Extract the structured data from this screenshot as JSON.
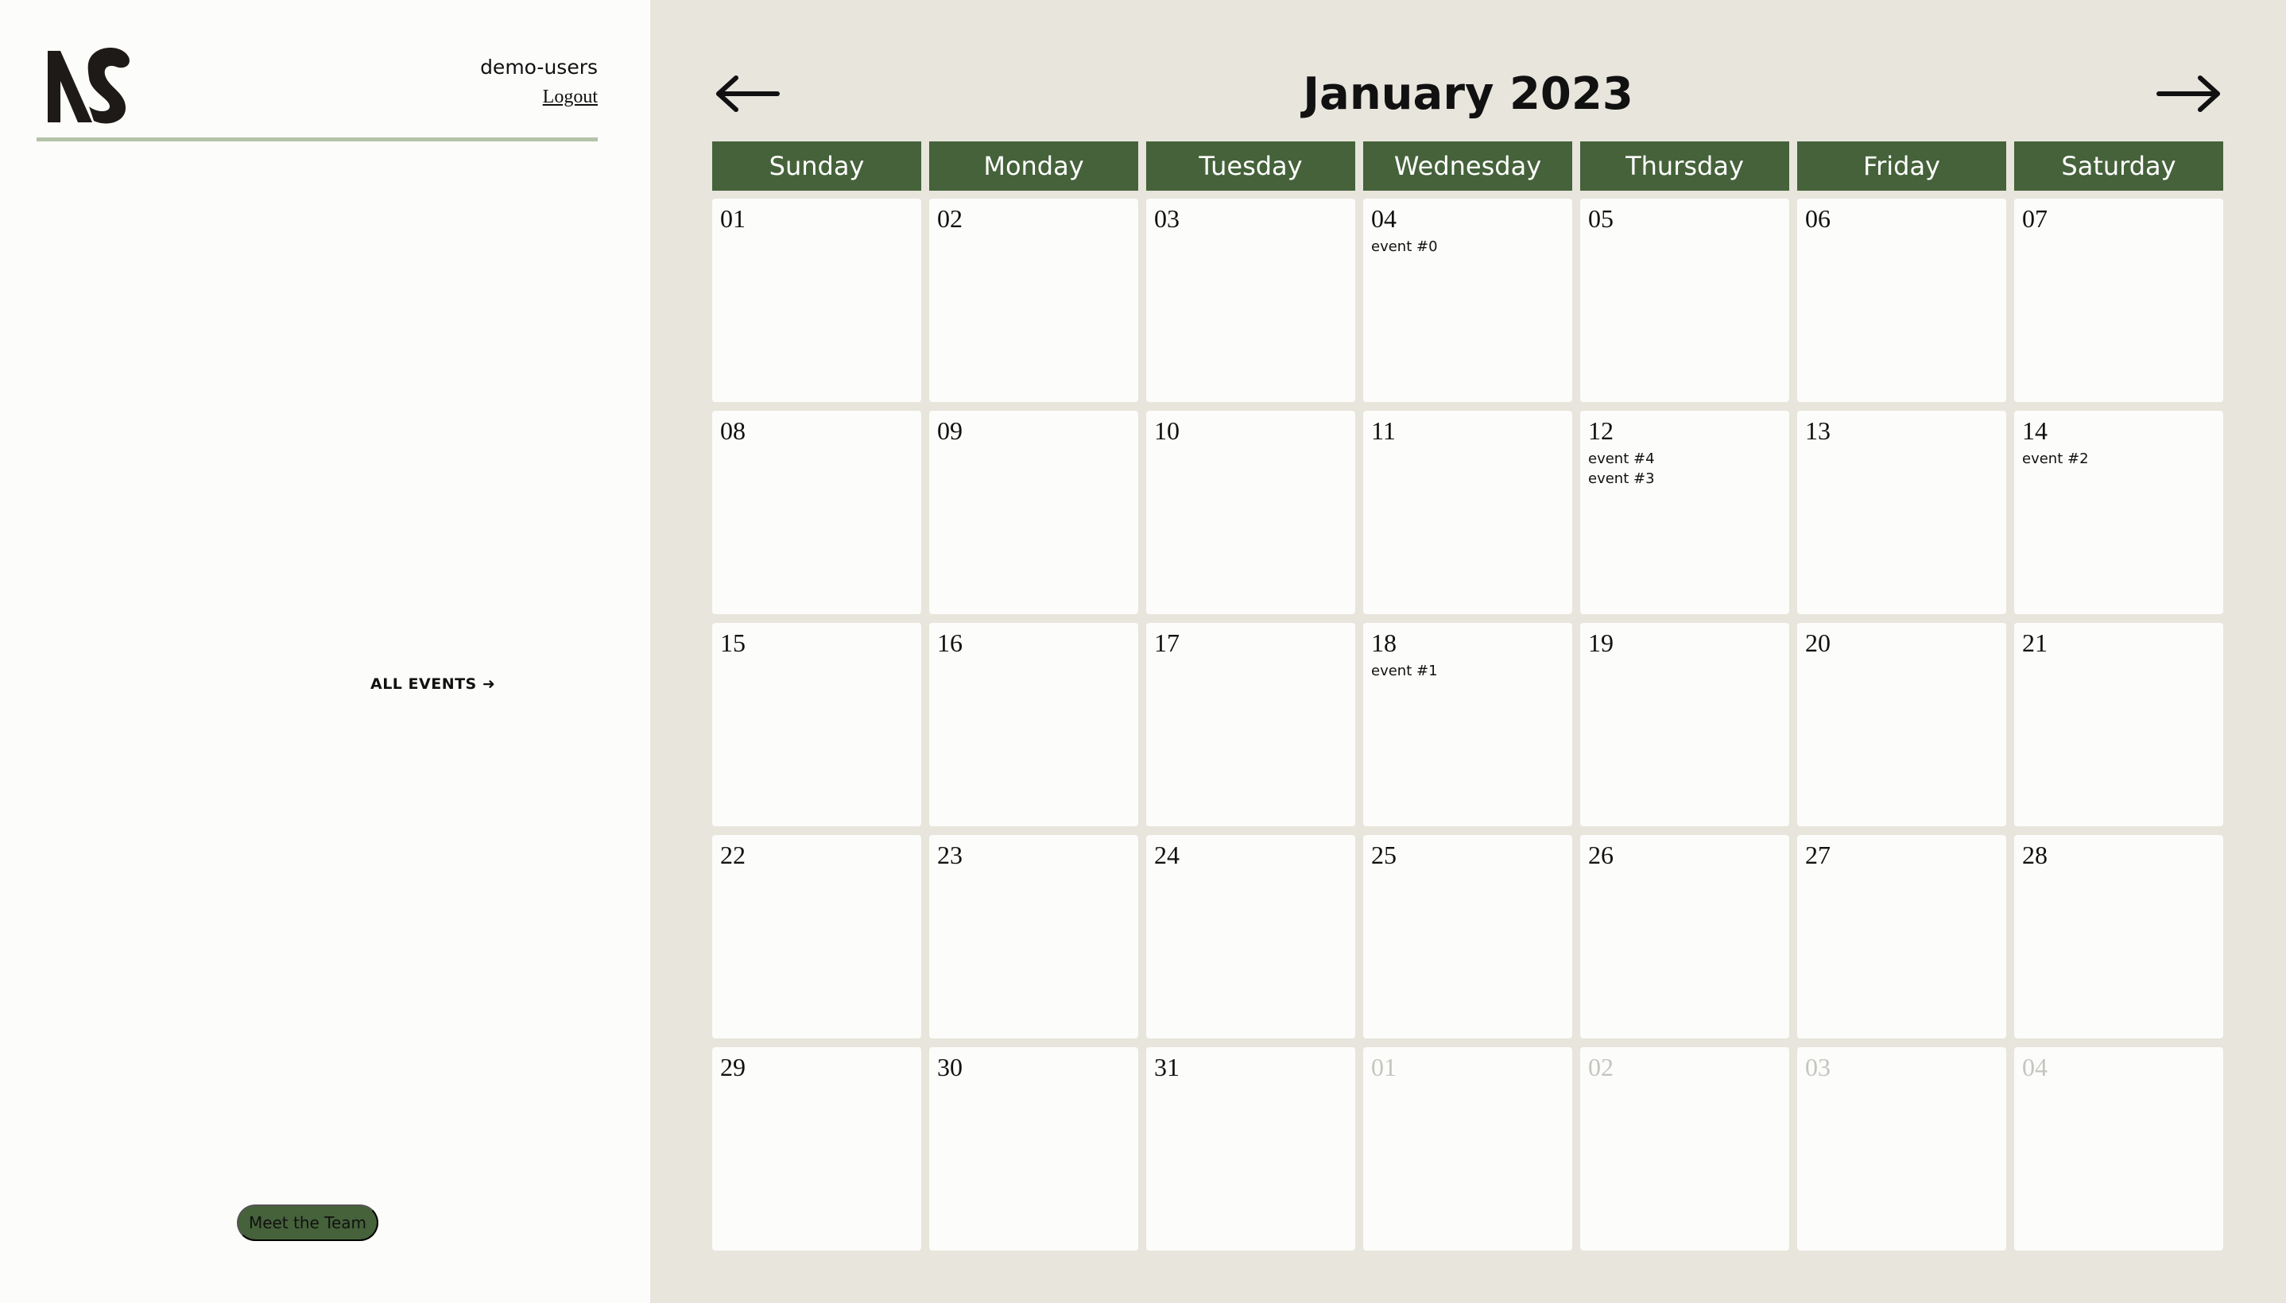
{
  "sidebar": {
    "username": "demo-users",
    "logout_label": "Logout",
    "all_events_label": "ALL EVENTS ➜",
    "meet_team_label": "Meet the Team"
  },
  "calendar": {
    "title": "January 2023",
    "weekdays": [
      "Sunday",
      "Monday",
      "Tuesday",
      "Wednesday",
      "Thursday",
      "Friday",
      "Saturday"
    ],
    "days": [
      {
        "num": "01",
        "events": []
      },
      {
        "num": "02",
        "events": []
      },
      {
        "num": "03",
        "events": []
      },
      {
        "num": "04",
        "events": [
          "event #0"
        ]
      },
      {
        "num": "05",
        "events": []
      },
      {
        "num": "06",
        "events": []
      },
      {
        "num": "07",
        "events": []
      },
      {
        "num": "08",
        "events": []
      },
      {
        "num": "09",
        "events": []
      },
      {
        "num": "10",
        "events": []
      },
      {
        "num": "11",
        "events": []
      },
      {
        "num": "12",
        "events": [
          "event #4",
          "event #3"
        ]
      },
      {
        "num": "13",
        "events": []
      },
      {
        "num": "14",
        "events": [
          "event #2"
        ]
      },
      {
        "num": "15",
        "events": []
      },
      {
        "num": "16",
        "events": []
      },
      {
        "num": "17",
        "events": []
      },
      {
        "num": "18",
        "events": [
          "event #1"
        ]
      },
      {
        "num": "19",
        "events": []
      },
      {
        "num": "20",
        "events": []
      },
      {
        "num": "21",
        "events": []
      },
      {
        "num": "22",
        "events": []
      },
      {
        "num": "23",
        "events": []
      },
      {
        "num": "24",
        "events": []
      },
      {
        "num": "25",
        "events": []
      },
      {
        "num": "26",
        "events": []
      },
      {
        "num": "27",
        "events": []
      },
      {
        "num": "28",
        "events": []
      },
      {
        "num": "29",
        "events": []
      },
      {
        "num": "30",
        "events": []
      },
      {
        "num": "31",
        "events": []
      },
      {
        "num": "01",
        "events": [],
        "other_month": true
      },
      {
        "num": "02",
        "events": [],
        "other_month": true
      },
      {
        "num": "03",
        "events": [],
        "other_month": true
      },
      {
        "num": "04",
        "events": [],
        "other_month": true
      }
    ]
  },
  "icons": {
    "logo": "ns-logo",
    "prev": "arrow-left-icon",
    "next": "arrow-right-icon"
  },
  "colors": {
    "accent": "#45623a",
    "main_bg": "#e7e5dc",
    "sidebar_bg": "#fcfcfa",
    "divider": "#b3c3a8"
  }
}
